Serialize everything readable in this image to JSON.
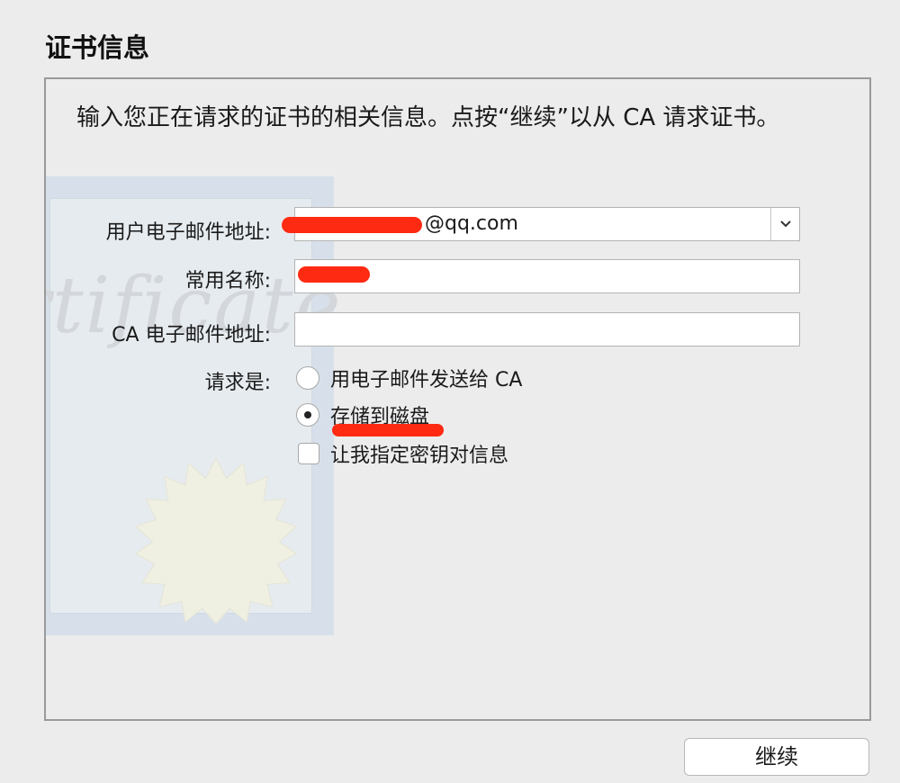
{
  "dialog": {
    "title": "证书信息",
    "intro": "输入您正在请求的证书的相关信息。点按“继续”以从 CA 请求证书。"
  },
  "form": {
    "email_label": "用户电子邮件地址:",
    "email_value": "@qq.com",
    "common_name_label": "常用名称:",
    "common_name_value": "",
    "ca_email_label": "CA 电子邮件地址:",
    "ca_email_value": "",
    "request_label": "请求是:",
    "options": [
      {
        "label": "用电子邮件发送给 CA",
        "selected": false
      },
      {
        "label": "存储到磁盘",
        "selected": true
      }
    ],
    "keypair_label": "让我指定密钥对信息",
    "keypair_checked": false
  },
  "watermark": {
    "word": "rtificate"
  },
  "footer": {
    "continue_label": "继续"
  },
  "colors": {
    "redaction": "#ff2a12",
    "background": "#ececec"
  }
}
